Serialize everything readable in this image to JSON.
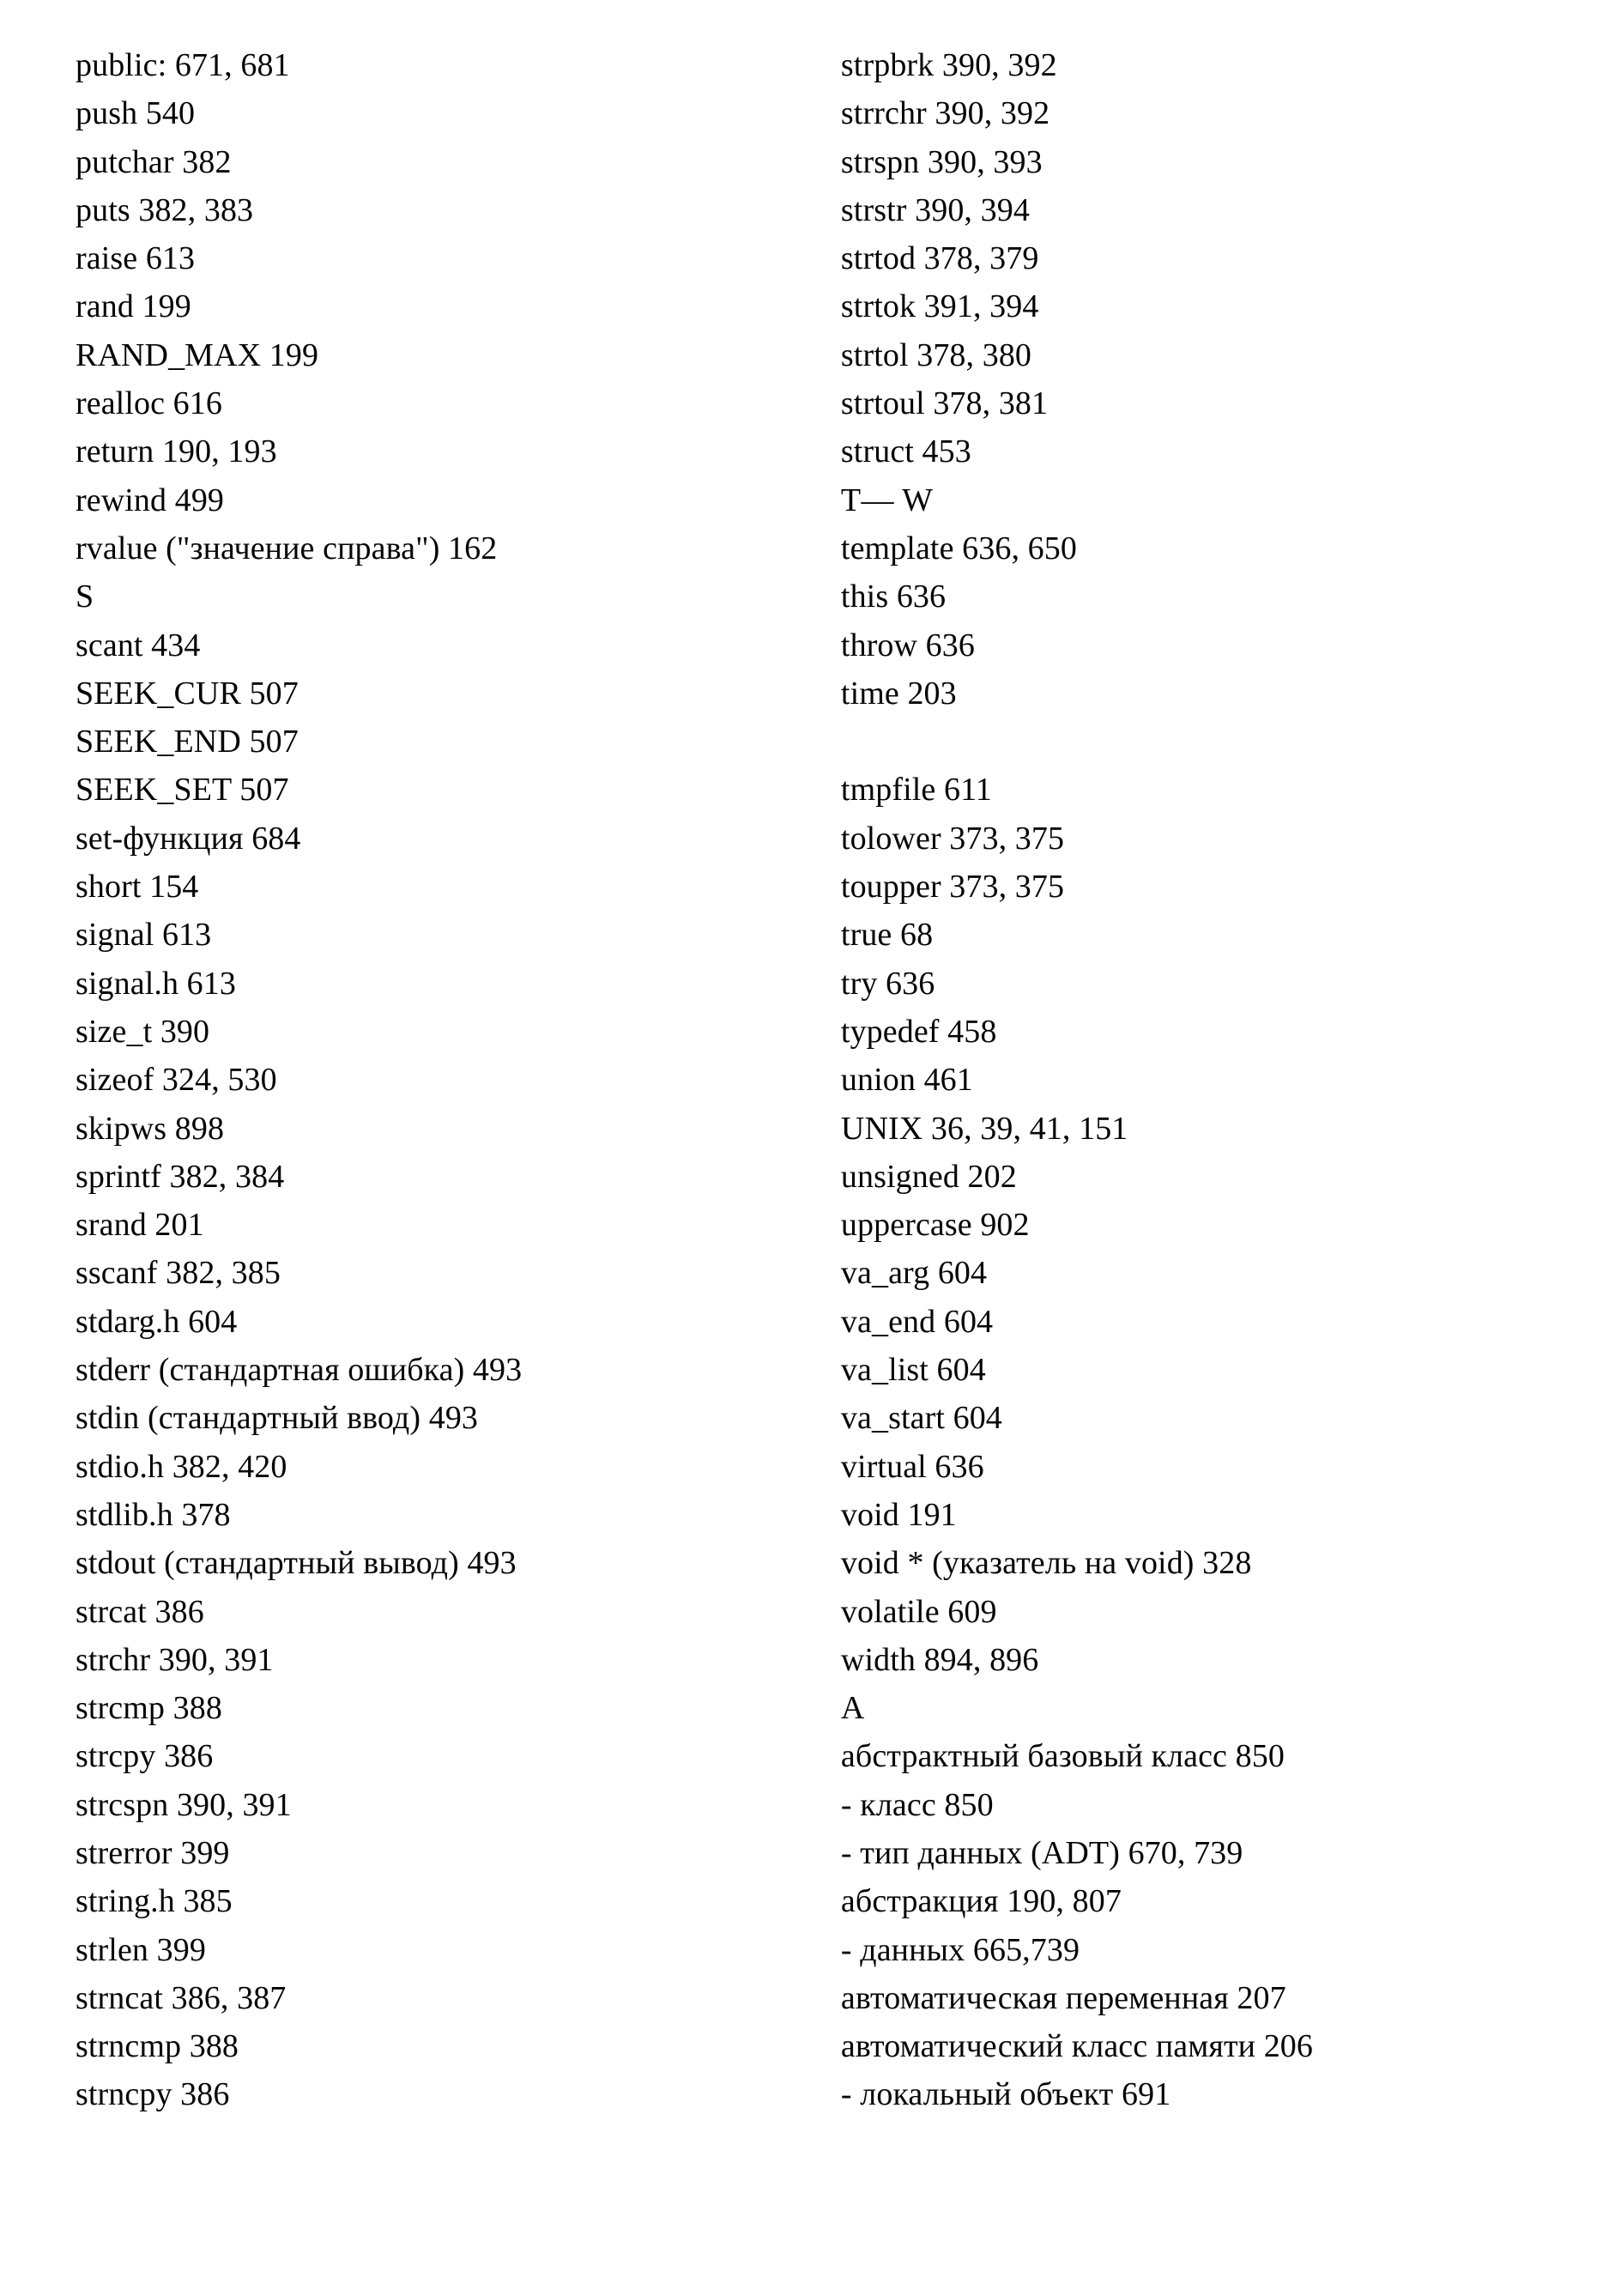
{
  "page": {
    "kind": "book-index",
    "columns": 2
  },
  "left_column": {
    "entries": [
      {
        "text": "public: 671, 681",
        "type": "entry"
      },
      {
        "text": "push 540",
        "type": "entry"
      },
      {
        "text": "putchar 382",
        "type": "entry"
      },
      {
        "text": "puts 382, 383",
        "type": "entry"
      },
      {
        "text": "raise 613",
        "type": "entry"
      },
      {
        "text": "rand 199",
        "type": "entry"
      },
      {
        "text": "RAND_MAX 199",
        "type": "entry"
      },
      {
        "text": "realloc 616",
        "type": "entry"
      },
      {
        "text": "return 190, 193",
        "type": "entry"
      },
      {
        "text": "rewind 499",
        "type": "entry"
      },
      {
        "text": "rvalue (\"значение справа\") 162",
        "type": "entry"
      },
      {
        "text": "S",
        "type": "section"
      },
      {
        "text": "scant 434",
        "type": "entry"
      },
      {
        "text": "SEEK_CUR 507",
        "type": "entry"
      },
      {
        "text": "SEEK_END 507",
        "type": "entry"
      },
      {
        "text": "SEEK_SET 507",
        "type": "entry"
      },
      {
        "text": "set-функция 684",
        "type": "entry"
      },
      {
        "text": "short 154",
        "type": "entry"
      },
      {
        "text": "signal 613",
        "type": "entry"
      },
      {
        "text": "signal.h 613",
        "type": "entry"
      },
      {
        "text": "size_t 390",
        "type": "entry"
      },
      {
        "text": "sizeof 324, 530",
        "type": "entry"
      },
      {
        "text": "skipws 898",
        "type": "entry"
      },
      {
        "text": "sprintf 382, 384",
        "type": "entry"
      },
      {
        "text": "srand 201",
        "type": "entry"
      },
      {
        "text": "sscanf 382, 385",
        "type": "entry"
      },
      {
        "text": "stdarg.h 604",
        "type": "entry"
      },
      {
        "text": "stderr (стандартная ошибка) 493",
        "type": "entry"
      },
      {
        "text": "stdin (стандартный ввод) 493",
        "type": "entry"
      },
      {
        "text": "stdio.h 382, 420",
        "type": "entry"
      },
      {
        "text": "stdlib.h 378",
        "type": "entry"
      },
      {
        "text": "stdout (стандартный вывод) 493",
        "type": "entry"
      },
      {
        "text": "strcat 386",
        "type": "entry"
      },
      {
        "text": "strchr 390, 391",
        "type": "entry"
      },
      {
        "text": "strcmp 388",
        "type": "entry"
      },
      {
        "text": "strcpy 386",
        "type": "entry"
      },
      {
        "text": "strcspn 390, 391",
        "type": "entry"
      },
      {
        "text": "strerror 399",
        "type": "entry"
      },
      {
        "text": "string.h 385",
        "type": "entry"
      },
      {
        "text": "strlen 399",
        "type": "entry"
      },
      {
        "text": "strncat 386, 387",
        "type": "entry"
      },
      {
        "text": "strncmp 388",
        "type": "entry"
      },
      {
        "text": "strncpy 386",
        "type": "entry"
      }
    ]
  },
  "right_column": {
    "entries": [
      {
        "text": "strpbrk 390, 392",
        "type": "entry"
      },
      {
        "text": "strrchr 390, 392",
        "type": "entry"
      },
      {
        "text": "strspn 390, 393",
        "type": "entry"
      },
      {
        "text": "strstr 390, 394",
        "type": "entry"
      },
      {
        "text": "strtod 378, 379",
        "type": "entry"
      },
      {
        "text": "strtok 391, 394",
        "type": "entry"
      },
      {
        "text": "strtol 378, 380",
        "type": "entry"
      },
      {
        "text": "strtoul 378, 381",
        "type": "entry"
      },
      {
        "text": "struct 453",
        "type": "entry"
      },
      {
        "text": "T— W",
        "type": "section"
      },
      {
        "text": "template 636, 650",
        "type": "entry"
      },
      {
        "text": "this 636",
        "type": "entry"
      },
      {
        "text": "throw 636",
        "type": "entry"
      },
      {
        "text": "time 203",
        "type": "entry"
      },
      {
        "text": " ",
        "type": "blank"
      },
      {
        "text": "tmpfile 611",
        "type": "entry"
      },
      {
        "text": "tolower 373, 375",
        "type": "entry"
      },
      {
        "text": "toupper 373, 375",
        "type": "entry"
      },
      {
        "text": "true 68",
        "type": "entry"
      },
      {
        "text": "try 636",
        "type": "entry"
      },
      {
        "text": "typedef 458",
        "type": "entry"
      },
      {
        "text": "union 461",
        "type": "entry"
      },
      {
        "text": "UNIX 36, 39, 41, 151",
        "type": "entry"
      },
      {
        "text": "unsigned 202",
        "type": "entry"
      },
      {
        "text": "uppercase 902",
        "type": "entry"
      },
      {
        "text": "va_arg 604",
        "type": "entry"
      },
      {
        "text": "va_end 604",
        "type": "entry"
      },
      {
        "text": "va_list 604",
        "type": "entry"
      },
      {
        "text": "va_start 604",
        "type": "entry"
      },
      {
        "text": "virtual 636",
        "type": "entry"
      },
      {
        "text": "void 191",
        "type": "entry"
      },
      {
        "text": "void * (указатель на void) 328",
        "type": "entry"
      },
      {
        "text": "volatile 609",
        "type": "entry"
      },
      {
        "text": "width 894, 896",
        "type": "entry"
      },
      {
        "text": "А",
        "type": "section"
      },
      {
        "text": "абстрактный базовый класс 850",
        "type": "entry"
      },
      {
        "text": "- класс 850",
        "type": "entry"
      },
      {
        "text": "- тип данных (ADT) 670, 739",
        "type": "entry"
      },
      {
        "text": "абстракция 190, 807",
        "type": "entry"
      },
      {
        "text": "- данных 665,739",
        "type": "entry"
      },
      {
        "text": "автоматическая переменная 207",
        "type": "entry"
      },
      {
        "text": "автоматический класс памяти 206",
        "type": "entry"
      },
      {
        "text": "- локальный объект 691",
        "type": "entry"
      }
    ]
  }
}
